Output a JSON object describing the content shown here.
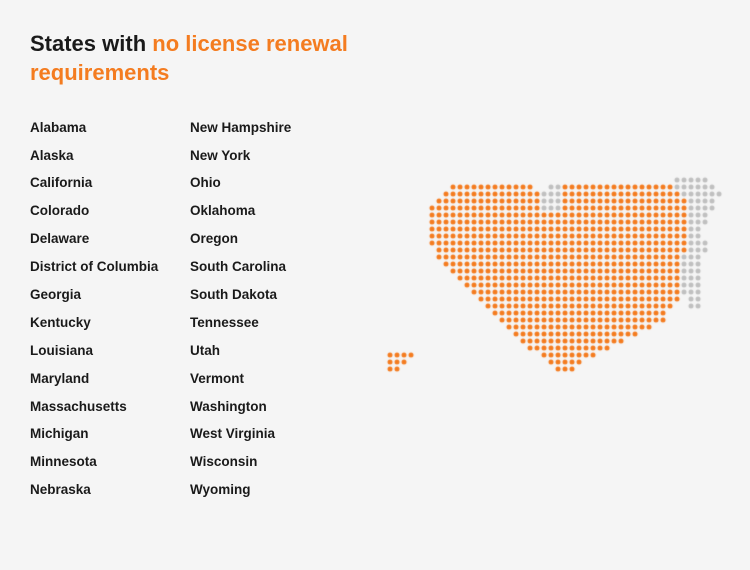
{
  "title": {
    "static": "States with ",
    "highlight": "no license renewal requirements"
  },
  "col1": [
    "Alabama",
    "Alaska",
    "California",
    "Colorado",
    "Delaware",
    "District of Columbia",
    "Georgia",
    "Kentucky",
    "Louisiana",
    "Maryland",
    "Massachusetts",
    "Michigan",
    "Minnesota",
    "Nebraska"
  ],
  "col2": [
    "New Hampshire",
    "New York",
    "Ohio",
    "Oklahoma",
    "Oregon",
    "South Carolina",
    "South Dakota",
    "Tennessee",
    "Utah",
    "Vermont",
    "Washington",
    "West Virginia",
    "Wisconsin",
    "Wyoming"
  ],
  "colors": {
    "orange": "#f47c20",
    "gray": "#b0b0b0",
    "bg": "#f5f5f5"
  }
}
